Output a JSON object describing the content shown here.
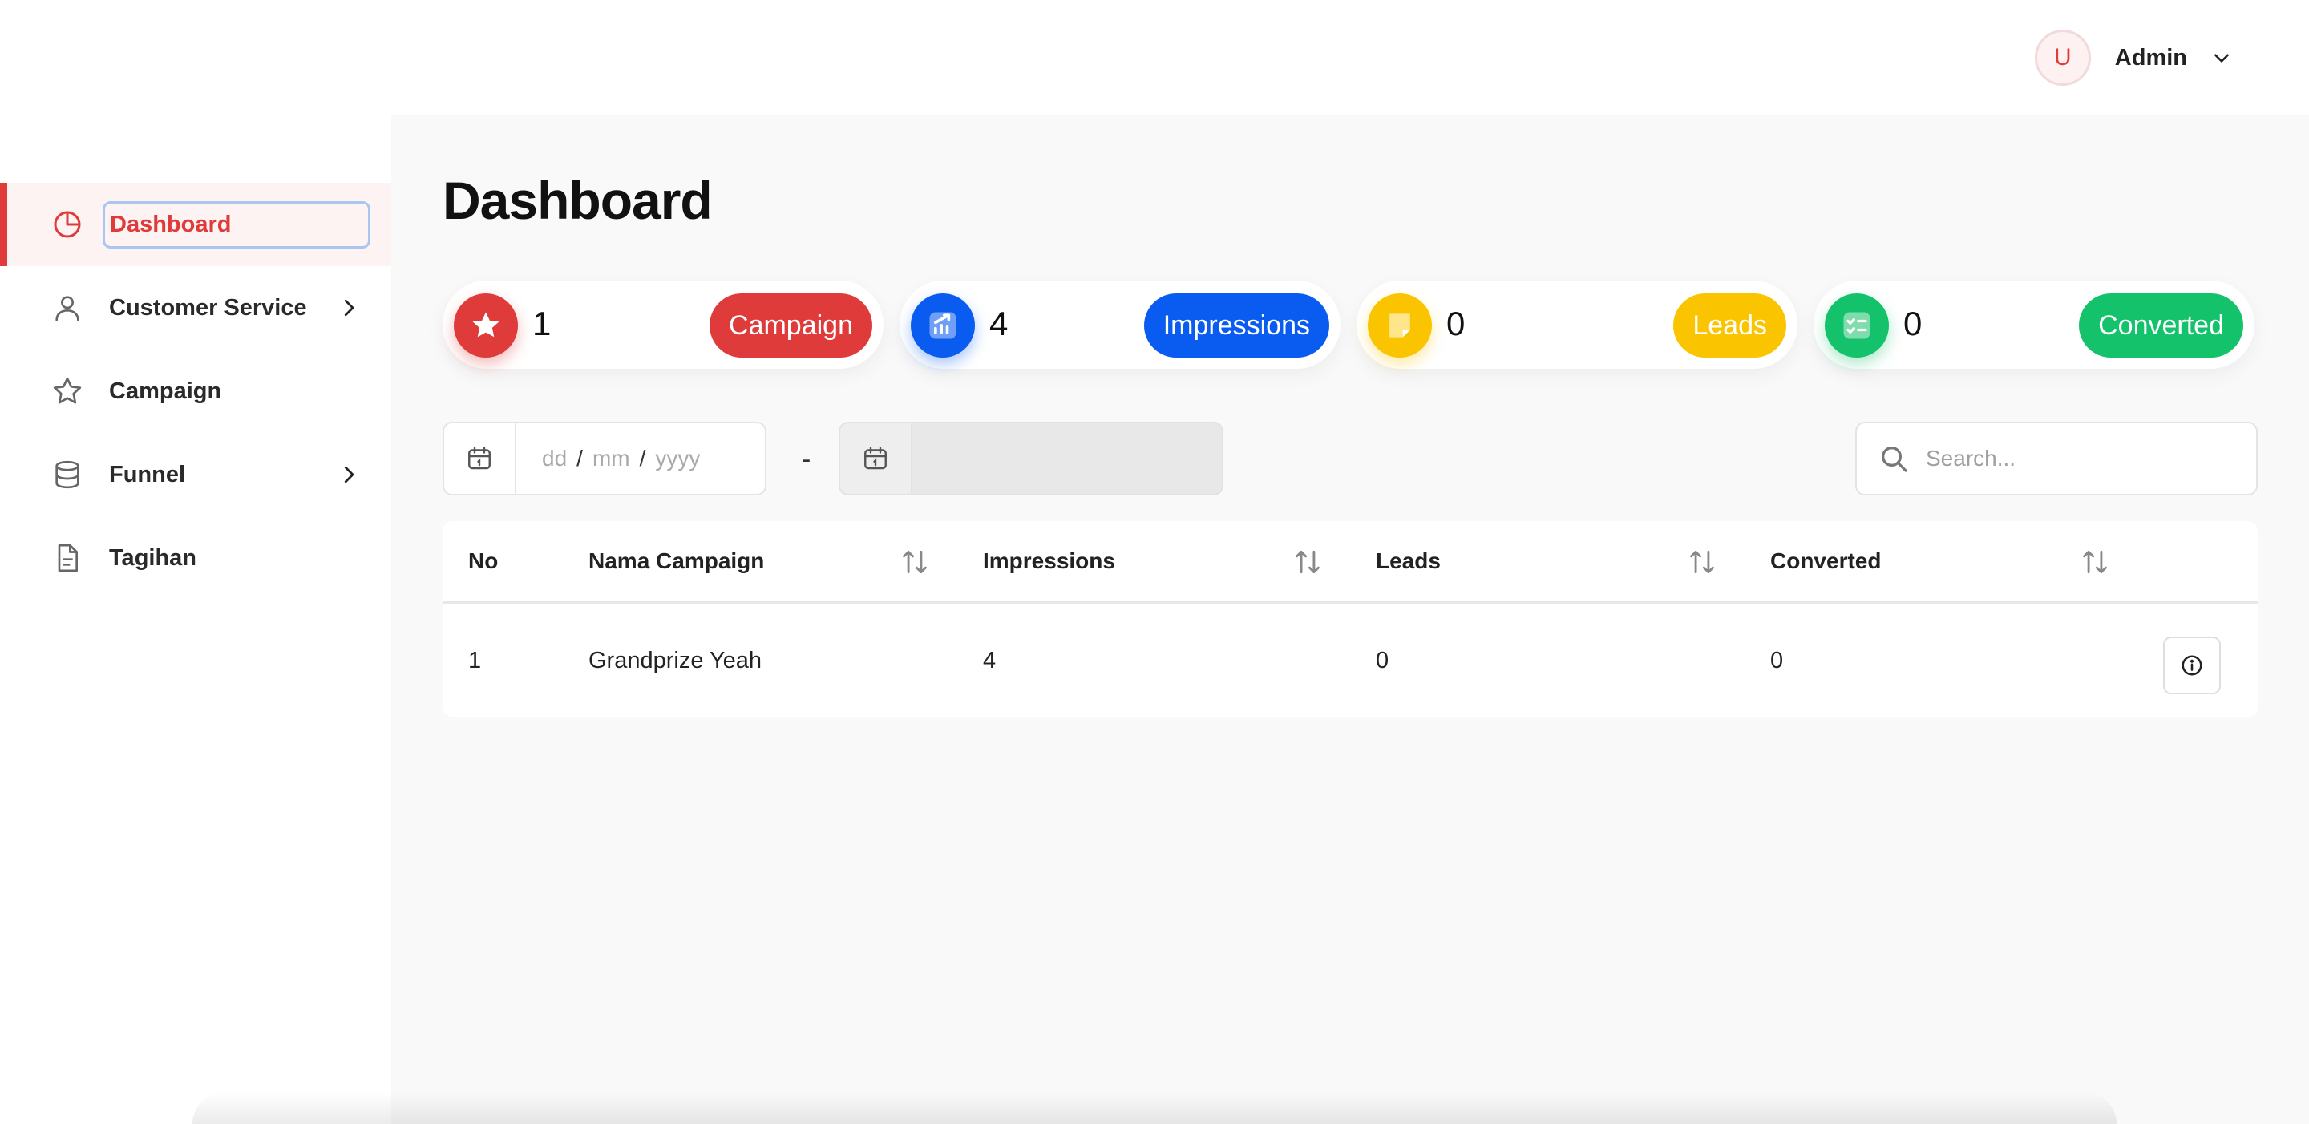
{
  "header": {
    "avatar_initial": "U",
    "user_name": "Admin"
  },
  "sidebar": {
    "items": [
      {
        "label": "Dashboard",
        "icon": "pie-chart-icon",
        "active": true
      },
      {
        "label": "Customer Service",
        "icon": "user-icon",
        "has_submenu": true
      },
      {
        "label": "Campaign",
        "icon": "star-icon"
      },
      {
        "label": "Funnel",
        "icon": "database-icon",
        "has_submenu": true
      },
      {
        "label": "Tagihan",
        "icon": "document-icon"
      }
    ]
  },
  "main": {
    "title": "Dashboard",
    "stats": [
      {
        "value": "1",
        "label": "Campaign",
        "color": "#e03b3b",
        "icon": "star-icon"
      },
      {
        "value": "4",
        "label": "Impressions",
        "color": "#0a5cf0",
        "icon": "chart-up-icon"
      },
      {
        "value": "0",
        "label": "Leads",
        "color": "#fbc400",
        "icon": "note-icon"
      },
      {
        "value": "0",
        "label": "Converted",
        "color": "#13c26a",
        "icon": "checklist-icon"
      }
    ],
    "date_filter": {
      "start": {
        "dd": "dd",
        "mm": "mm",
        "yyyy": "yyyy",
        "sep": "/"
      },
      "dash": "-"
    },
    "search": {
      "placeholder": "Search..."
    },
    "table": {
      "columns": [
        "No",
        "Nama Campaign",
        "Impressions",
        "Leads",
        "Converted"
      ],
      "rows": [
        [
          "1",
          "Grandprize Yeah",
          "4",
          "0",
          "0"
        ]
      ]
    }
  },
  "colors": {
    "accent": "#e03b3b",
    "background": "#f9f9f9"
  }
}
